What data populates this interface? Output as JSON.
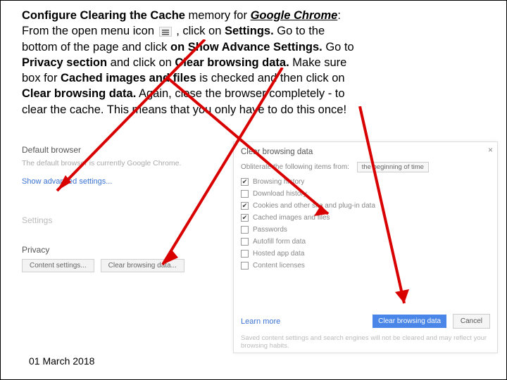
{
  "instructions": {
    "title_bold": "Configure Clearing the Cache",
    "title_rest": "memory for",
    "title_chrome": "Google Chrome",
    "l2a": "From the open menu icon",
    "l2b": ", click on",
    "l2_settings": "Settings.",
    "l2c": "Go to the",
    "l3a": "bottom of the page and click",
    "l3_show": "on Show Advance Settings.",
    "l3b": "Go to",
    "l4_privacy": "Privacy section",
    "l4a": "and click on",
    "l4_clear": "Clear browsing data.",
    "l4b": "Make sure",
    "l5a": "box for",
    "l5_cached": "Cached images and files",
    "l5b": "is checked and then click on",
    "l6_clear": "Clear browsing data.",
    "l6a": "Again, close the browser completely - to",
    "l7": "clear the cache.  This means that you only have to do this once!"
  },
  "left": {
    "section_default": "Default browser",
    "default_text": "The default browser is currently Google Chrome.",
    "show_adv": "Show advanced settings...",
    "section_settings": "Settings",
    "section_privacy": "Privacy",
    "btn_content": "Content settings...",
    "btn_clear": "Clear browsing data..."
  },
  "right": {
    "title": "Clear browsing data",
    "obliterate": "Obliterate the following items from:",
    "range": "the beginning of time",
    "options": [
      {
        "label": "Browsing history",
        "checked": true
      },
      {
        "label": "Download history",
        "checked": false
      },
      {
        "label": "Cookies and other site and plug-in data",
        "checked": true
      },
      {
        "label": "Cached images and files",
        "checked": true
      },
      {
        "label": "Passwords",
        "checked": false
      },
      {
        "label": "Autofill form data",
        "checked": false
      },
      {
        "label": "Hosted app data",
        "checked": false
      },
      {
        "label": "Content licenses",
        "checked": false
      }
    ],
    "learn_more": "Learn more",
    "btn_clear": "Clear browsing data",
    "btn_cancel": "Cancel",
    "note": "Saved content settings and search engines will not be cleared and may reflect your browsing habits."
  },
  "date": "01 March 2018"
}
